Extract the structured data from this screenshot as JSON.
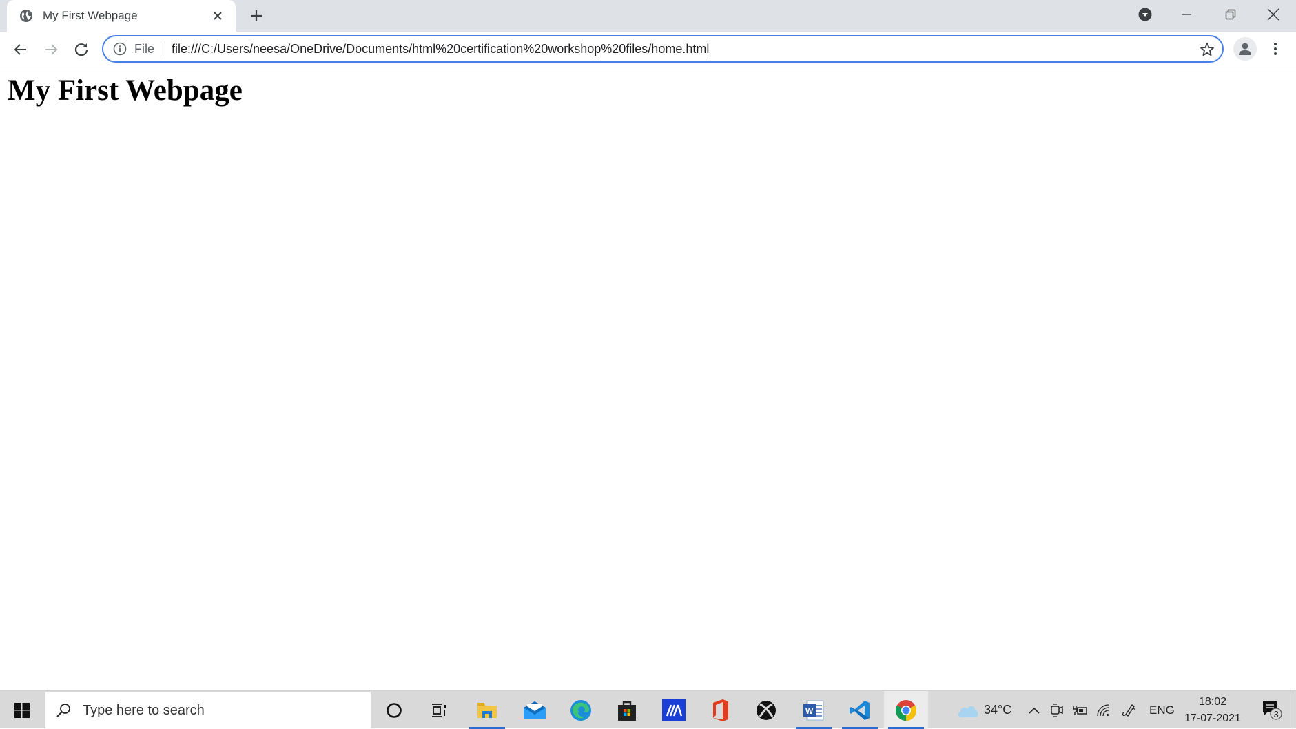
{
  "browser": {
    "tab": {
      "title": "My First Webpage",
      "favicon": "globe-icon",
      "close": "close-icon"
    },
    "new_tab": "plus-icon",
    "window_controls": [
      "profile-dropdown-icon",
      "minimize-icon",
      "restore-icon",
      "close-icon"
    ],
    "toolbar": {
      "back": "back-arrow-icon",
      "forward": "forward-arrow-icon",
      "reload": "reload-icon",
      "info": "info-icon",
      "scheme_label": "File",
      "url": "file:///C:/Users/neesa/OneDrive/Documents/html%20certification%20workshop%20files/home.html",
      "bookmark": "star-icon",
      "profile": "profile-icon",
      "menu": "kebab-menu-icon"
    },
    "accent": "#4a80e6"
  },
  "page": {
    "heading": "My First Webpage"
  },
  "taskbar": {
    "start": "windows-logo-icon",
    "search_placeholder": "Type here to search",
    "pinned": [
      {
        "name": "cortana",
        "icon": "cortana-circle-icon",
        "active": false
      },
      {
        "name": "task-view",
        "icon": "task-view-icon",
        "active": false
      },
      {
        "name": "file-explorer",
        "icon": "folder-icon",
        "active": true
      },
      {
        "name": "mail",
        "icon": "mail-icon",
        "active": false
      },
      {
        "name": "edge",
        "icon": "edge-icon",
        "active": false
      },
      {
        "name": "store",
        "icon": "store-bag-icon",
        "active": false
      },
      {
        "name": "mathpix",
        "icon": "mathpix-icon",
        "active": false
      },
      {
        "name": "office",
        "icon": "office-icon",
        "active": false
      },
      {
        "name": "xbox",
        "icon": "xbox-icon",
        "active": false
      },
      {
        "name": "word",
        "icon": "word-icon",
        "active": true
      },
      {
        "name": "vscode",
        "icon": "vscode-icon",
        "active": true
      },
      {
        "name": "chrome",
        "icon": "chrome-icon",
        "active": true
      }
    ],
    "tray": {
      "weather_temp": "34°C",
      "language": "ENG",
      "time": "18:02",
      "date": "17-07-2021",
      "notifications_count": "3"
    }
  }
}
